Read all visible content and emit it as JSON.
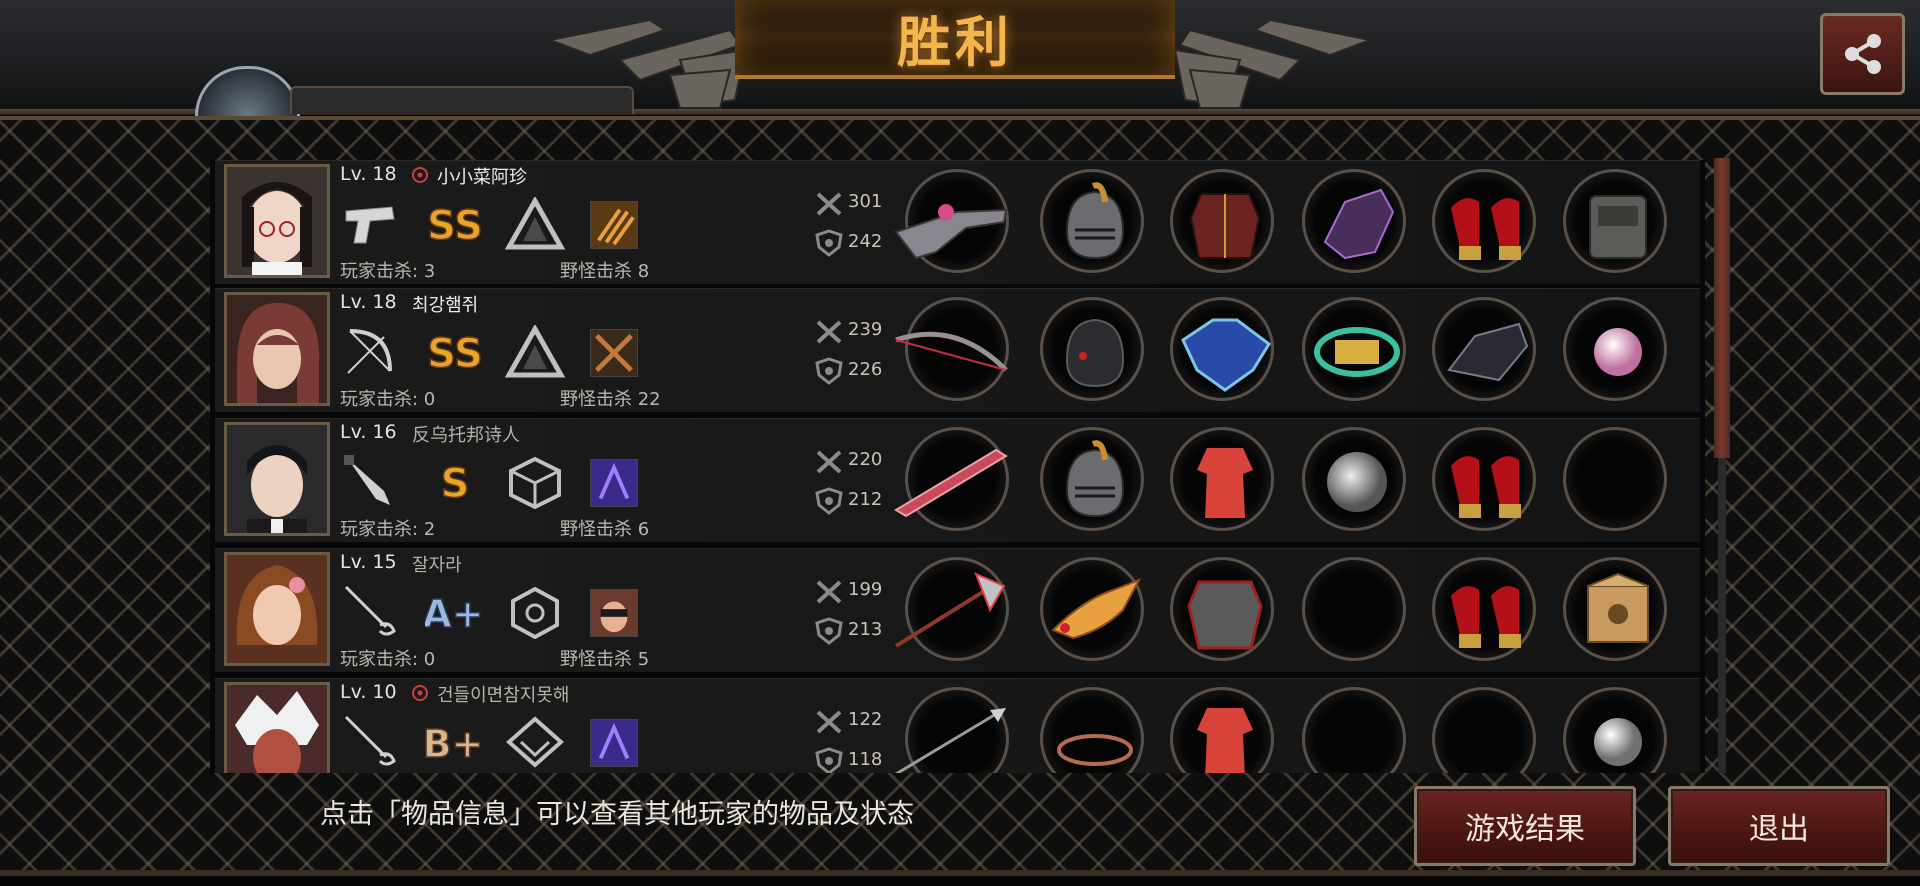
{
  "header": {
    "title": "胜利",
    "share_icon": "share-icon"
  },
  "players": [
    {
      "level": "Lv. 18",
      "name": "小小菜阿珍",
      "has_clan_icon": true,
      "weapon_icon": "pistol-icon",
      "grade": "SS",
      "rank_icon": "triangle-rank-icon",
      "skill_icon": "claw-skill-icon",
      "player_kills": "玩家击杀: 3",
      "monster_kills": "野怪击杀 8",
      "attack": "301",
      "defense": "242",
      "items": [
        "gun-item",
        "helmet-item",
        "armor-item",
        "gauntlet-item",
        "heels-item",
        "backpack-item"
      ]
    },
    {
      "level": "Lv. 18",
      "name": "최강햄쥐",
      "has_clan_icon": false,
      "weapon_icon": "bow-icon",
      "grade": "SS",
      "rank_icon": "triangle-rank-icon",
      "skill_icon": "cross-skill-icon",
      "player_kills": "玩家击杀: 0",
      "monster_kills": "野怪击杀 22",
      "attack": "239",
      "defense": "226",
      "items": [
        "bow-item",
        "black-helmet-item",
        "blue-robe-item",
        "gold-bracelet-item",
        "black-gauntlet-item",
        "pearl-item"
      ]
    },
    {
      "level": "Lv. 16",
      "name": "反乌托邦诗人",
      "has_clan_icon": false,
      "weapon_icon": "knife-icon",
      "grade": "S",
      "rank_icon": "cube-rank-icon",
      "skill_icon": "purple-skill-icon",
      "player_kills": "玩家击杀: 2",
      "monster_kills": "野怪击杀 6",
      "attack": "220",
      "defense": "212",
      "items": [
        "blade-item",
        "helmet-item",
        "red-suit-item",
        "disc-item",
        "heels-item",
        "empty-slot"
      ]
    },
    {
      "level": "Lv. 15",
      "name": "잘자라",
      "has_clan_icon": false,
      "weapon_icon": "rapier-icon",
      "grade": "A+",
      "rank_icon": "hex-rank-icon",
      "skill_icon": "face-skill-icon",
      "player_kills": "玩家击杀: 0",
      "monster_kills": "野怪击杀 5",
      "attack": "199",
      "defense": "213",
      "items": [
        "axe-item",
        "tiara-item",
        "plate-armor-item",
        "empty-slot",
        "heels-item",
        "box-item"
      ]
    },
    {
      "level": "Lv. 10",
      "name": "건들이면참지못해",
      "has_clan_icon": true,
      "weapon_icon": "rapier-icon",
      "grade": "B+",
      "rank_icon": "diamond-rank-icon",
      "skill_icon": "purple-skill-icon",
      "player_kills": "",
      "monster_kills": "",
      "attack": "122",
      "defense": "118",
      "items": [
        "spear-item",
        "ring-item",
        "red-suit-item",
        "empty-slot",
        "empty-slot",
        "silver-orb-item"
      ]
    }
  ],
  "footer": {
    "hint": "点击「物品信息」可以查看其他玩家的物品及状态",
    "result_button": "游戏结果",
    "exit_button": "退出"
  },
  "colors": {
    "title": "#f3b64c",
    "button_bg": "#4a1612",
    "grade_gold": "#e9a42a",
    "grade_blue": "#9ab8e0",
    "grade_tan": "#d8b490"
  }
}
